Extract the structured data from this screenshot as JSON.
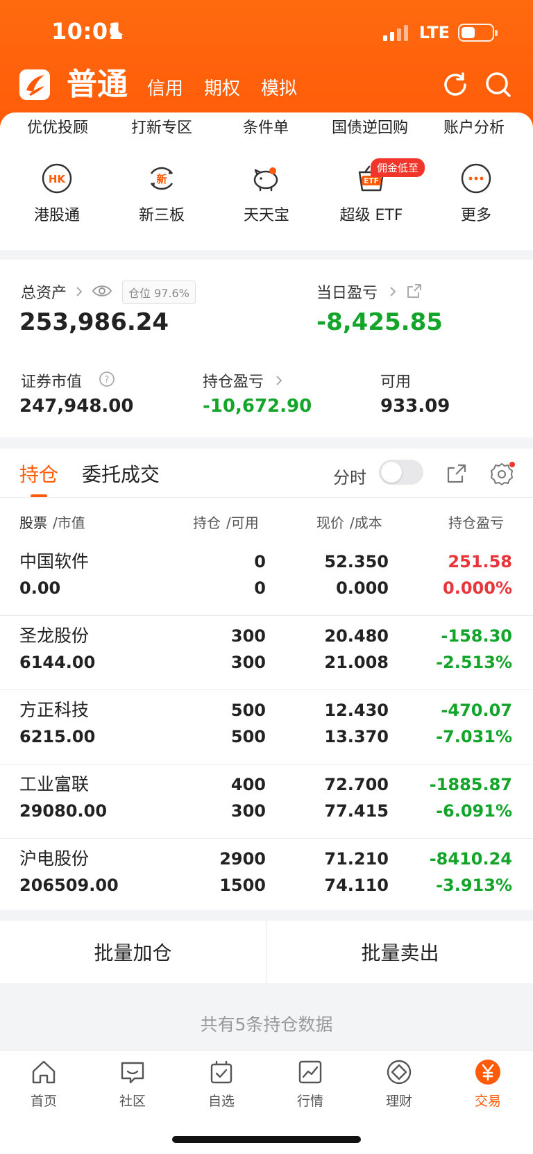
{
  "status_bar": {
    "time": "10:01",
    "network": "LTE"
  },
  "header": {
    "account_type": "普通",
    "tabs": [
      "信用",
      "期权",
      "模拟"
    ]
  },
  "top_links": [
    "优优投顾",
    "打新专区",
    "条件单",
    "国债逆回购",
    "账户分析"
  ],
  "services": [
    {
      "label": "港股通",
      "icon": "hk-icon",
      "glyph": "HK"
    },
    {
      "label": "新三板",
      "icon": "xin-icon",
      "glyph": "新"
    },
    {
      "label": "天天宝",
      "icon": "piggy-bank-icon"
    },
    {
      "label": "超级 ETF",
      "icon": "etf-basket-icon",
      "glyph": "ETF",
      "badge": "佣金低至"
    },
    {
      "label": "更多",
      "icon": "more-dots-icon"
    }
  ],
  "assets": {
    "total_label": "总资产",
    "total_value": "253,986.24",
    "position_ratio": "仓位 97.6%",
    "daily_pl_label": "当日盈亏",
    "daily_pl_value": "-8,425.85",
    "market_value_label": "证券市值",
    "market_value": "247,948.00",
    "holding_pl_label": "持仓盈亏",
    "holding_pl_value": "-10,672.90",
    "available_label": "可用",
    "available_value": "933.09"
  },
  "holdings": {
    "tabs": [
      "持仓",
      "委托成交"
    ],
    "toggle_label": "分时",
    "headers": [
      "股票",
      "/市值",
      "持仓",
      "/可用",
      "现价",
      "/成本",
      "持仓盈亏"
    ],
    "rows": [
      {
        "name": "中国软件",
        "market_value": "0.00",
        "position": "0",
        "available": "0",
        "price": "52.350",
        "cost": "0.000",
        "pl": "251.58",
        "pl_pct": "0.000%",
        "sign": "up"
      },
      {
        "name": "圣龙股份",
        "market_value": "6144.00",
        "position": "300",
        "available": "300",
        "price": "20.480",
        "cost": "21.008",
        "pl": "-158.30",
        "pl_pct": "-2.513%",
        "sign": "down"
      },
      {
        "name": "方正科技",
        "market_value": "6215.00",
        "position": "500",
        "available": "500",
        "price": "12.430",
        "cost": "13.370",
        "pl": "-470.07",
        "pl_pct": "-7.031%",
        "sign": "down"
      },
      {
        "name": "工业富联",
        "market_value": "29080.00",
        "position": "400",
        "available": "300",
        "price": "72.700",
        "cost": "77.415",
        "pl": "-1885.87",
        "pl_pct": "-6.091%",
        "sign": "down"
      },
      {
        "name": "沪电股份",
        "market_value": "206509.00",
        "position": "2900",
        "available": "1500",
        "price": "71.210",
        "cost": "74.110",
        "pl": "-8410.24",
        "pl_pct": "-3.913%",
        "sign": "down"
      }
    ]
  },
  "actions": {
    "batch_add": "批量加仓",
    "batch_sell": "批量卖出"
  },
  "summary": "共有5条持仓数据",
  "tabbar": [
    {
      "label": "首页",
      "icon": "home-icon"
    },
    {
      "label": "社区",
      "icon": "community-icon"
    },
    {
      "label": "自选",
      "icon": "watchlist-icon"
    },
    {
      "label": "行情",
      "icon": "market-chart-icon"
    },
    {
      "label": "理财",
      "icon": "wealth-diamond-icon"
    },
    {
      "label": "交易",
      "icon": "trade-yen-icon",
      "active": true
    }
  ],
  "colors": {
    "brand": "#ff5a08",
    "up": "#e8353a",
    "down": "#12a52a"
  }
}
